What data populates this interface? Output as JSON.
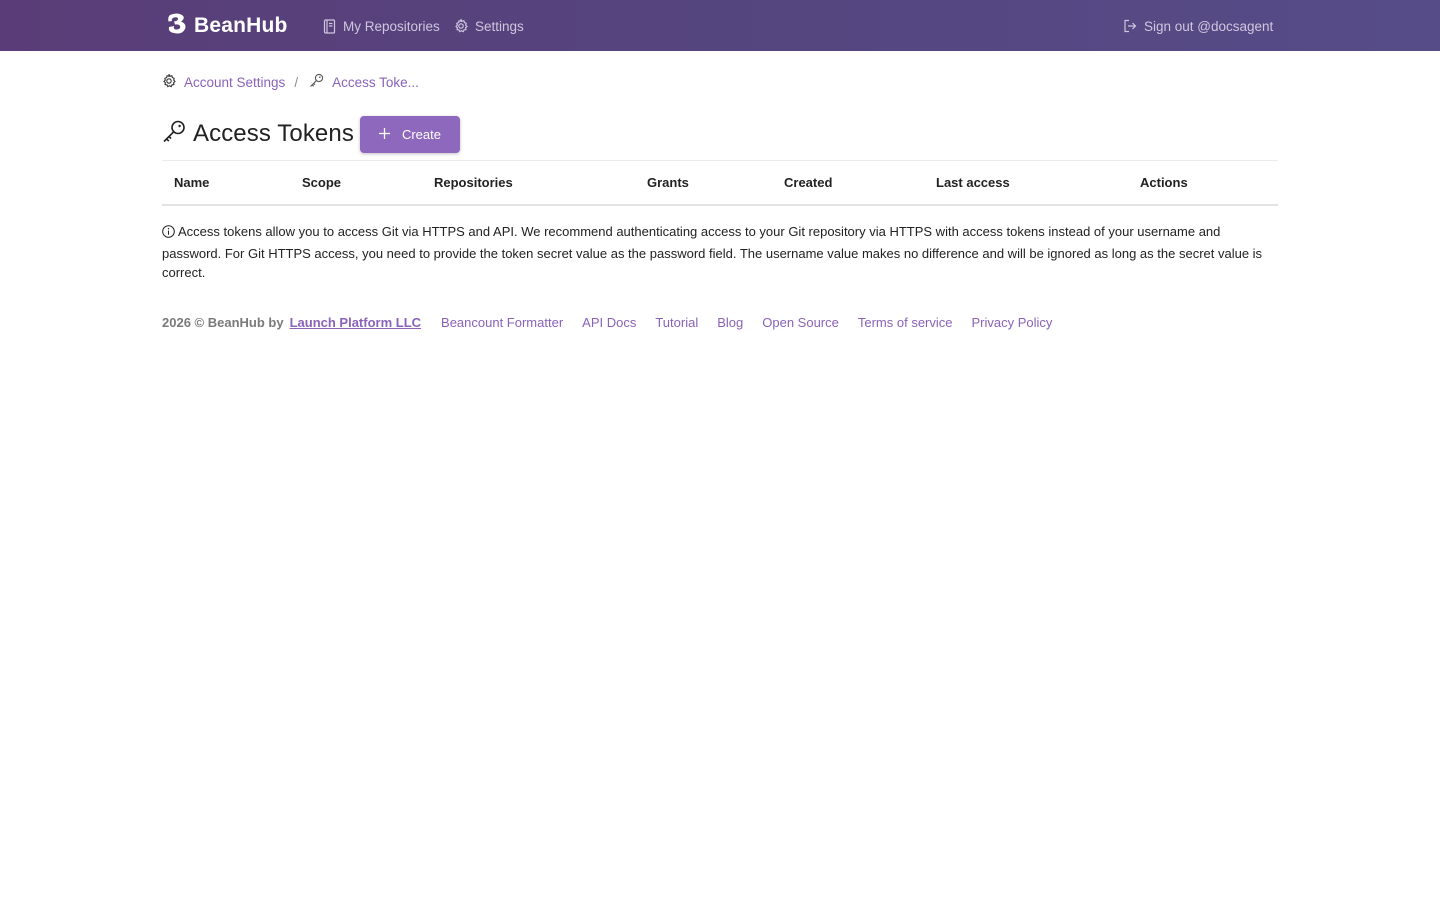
{
  "navbar": {
    "brand": "BeanHub",
    "items": [
      {
        "label": "My Repositories",
        "icon": "book-icon"
      },
      {
        "label": "Settings",
        "icon": "gear-icon"
      }
    ],
    "signout": {
      "label": "Sign out @docsagent",
      "icon": "sign-out-icon"
    },
    "colors": {
      "gradient_start": "#5a3d78",
      "gradient_end": "#564c88"
    }
  },
  "breadcrumb": {
    "items": [
      {
        "label": "Account Settings",
        "icon": "gear-icon"
      },
      {
        "label": "Access Toke...",
        "icon": "key-icon"
      }
    ],
    "separator": "/"
  },
  "page": {
    "title": "Access Tokens",
    "title_icon": "key-icon",
    "create_label": "Create",
    "accent_color": "#8e68bd"
  },
  "table": {
    "columns": [
      "Name",
      "Scope",
      "Repositories",
      "Grants",
      "Created",
      "Last access",
      "Actions"
    ],
    "rows": []
  },
  "notice": {
    "icon": "info-icon",
    "text": "Access tokens allow you to access Git via HTTPS and API. We recommend authenticating access to your Git repository via HTTPS with access tokens instead of your username and password. For Git HTTPS access, you need to provide the token secret value as the password field. The username value makes no difference and will be ignored as long as the secret value is correct."
  },
  "footer": {
    "copyright": "2026 © BeanHub by",
    "company": "Launch Platform LLC",
    "links": [
      "Beancount Formatter",
      "API Docs",
      "Tutorial",
      "Blog",
      "Open Source",
      "Terms of service",
      "Privacy Policy"
    ]
  }
}
